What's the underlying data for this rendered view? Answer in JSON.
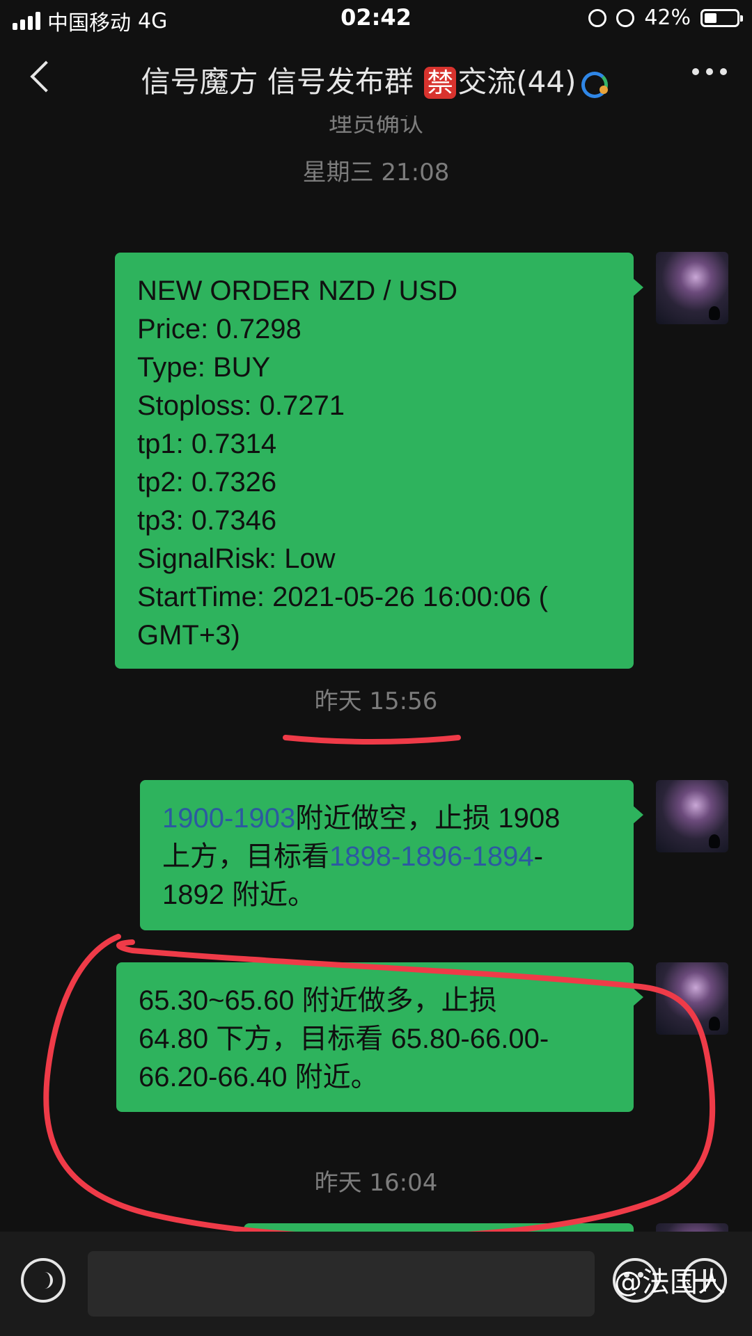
{
  "status_bar": {
    "carrier": "中国移动",
    "network": "4G",
    "time": "02:42",
    "battery": "42%"
  },
  "header": {
    "title_part1": "信号魔方 信号发布群",
    "ban_emoji": "禁",
    "title_part2": "交流(44)"
  },
  "chat": {
    "partial_top_text": "理员确认",
    "messages": [
      {
        "timestamp": "星期三 21:08",
        "lines": [
          "NEW ORDER NZD / USD",
          "Price: 0.7298",
          "Type: BUY",
          "Stoploss: 0.7271",
          "tp1: 0.7314",
          "tp2: 0.7326",
          "tp3: 0.7346",
          "SignalRisk: Low",
          "StartTime: 2021-05-26 16:00:06 (",
          "GMT+3)"
        ]
      },
      {
        "timestamp": "昨天 15:56",
        "link1": "1900-1903",
        "text1": "附近做空，止损 1908",
        "text2": "上方，目标看",
        "link2": "1898-1896-1894",
        "text3": "-",
        "text4": "1892 附近。"
      },
      {
        "lines": [
          "65.30~65.60 附近做多，止损",
          "64.80 下方，目标看 65.80-66.00-",
          "66.20-66.40 附近。"
        ]
      },
      {
        "timestamp": "昨天 16:04"
      }
    ]
  },
  "watermark": "@法国人",
  "colors": {
    "bubble": "#2eb35d",
    "link": "#2c5aa0",
    "annotation": "#ef3b48",
    "background": "#111111"
  },
  "icons": [
    "back-arrow-icon",
    "more-icon",
    "voice-icon",
    "emoji-icon",
    "plus-icon",
    "group-chat-icon"
  ]
}
